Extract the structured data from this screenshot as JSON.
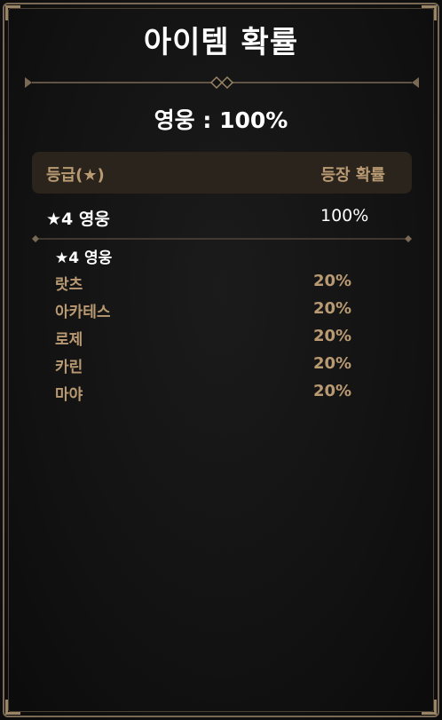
{
  "title": "아이템 확률",
  "summary": "영웅 : 100%",
  "table": {
    "header_grade": "등급(★)",
    "header_rate": "등장 확률"
  },
  "group": {
    "label": "★4 영웅",
    "rate": "100%",
    "sub_label": "★4 영웅",
    "items": [
      {
        "name": "랏츠",
        "rate": "20%"
      },
      {
        "name": "아카테스",
        "rate": "20%"
      },
      {
        "name": "로제",
        "rate": "20%"
      },
      {
        "name": "카린",
        "rate": "20%"
      },
      {
        "name": "마야",
        "rate": "20%"
      }
    ]
  },
  "colors": {
    "accent_gold": "#b99a72",
    "frame": "#7a6a55",
    "header_bg": "#2a241d",
    "text_white": "#ffffff"
  }
}
